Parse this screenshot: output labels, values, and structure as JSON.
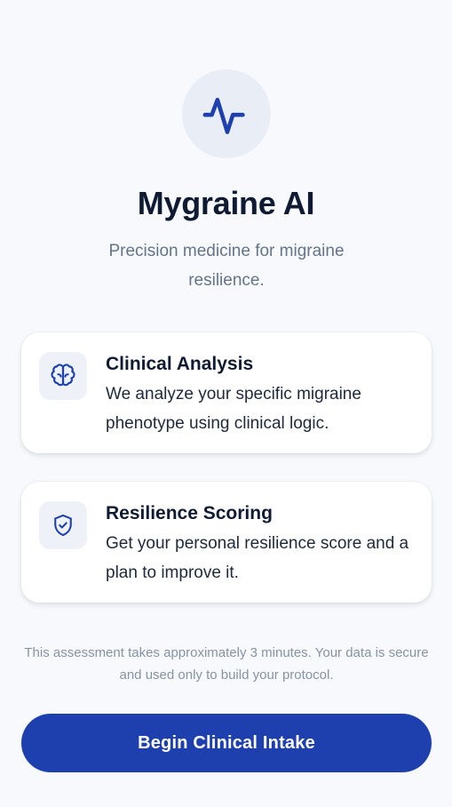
{
  "app": {
    "title": "Mygraine AI",
    "tagline": "Precision medicine for migraine resilience."
  },
  "features": [
    {
      "icon": "brain-icon",
      "title": "Clinical Analysis",
      "description": "We analyze your specific migraine phenotype using clinical logic."
    },
    {
      "icon": "shield-check-icon",
      "title": "Resilience Scoring",
      "description": "Get your personal resilience score and a plan to improve it."
    }
  ],
  "disclaimer": "This assessment takes approximately 3 minutes. Your data is secure and used only to build your protocol.",
  "cta": {
    "label": "Begin Clinical Intake"
  },
  "colors": {
    "primary": "#1e40af",
    "background": "#f7f9fc",
    "icon_bg": "#eef2f8",
    "text_muted": "#64748b"
  }
}
